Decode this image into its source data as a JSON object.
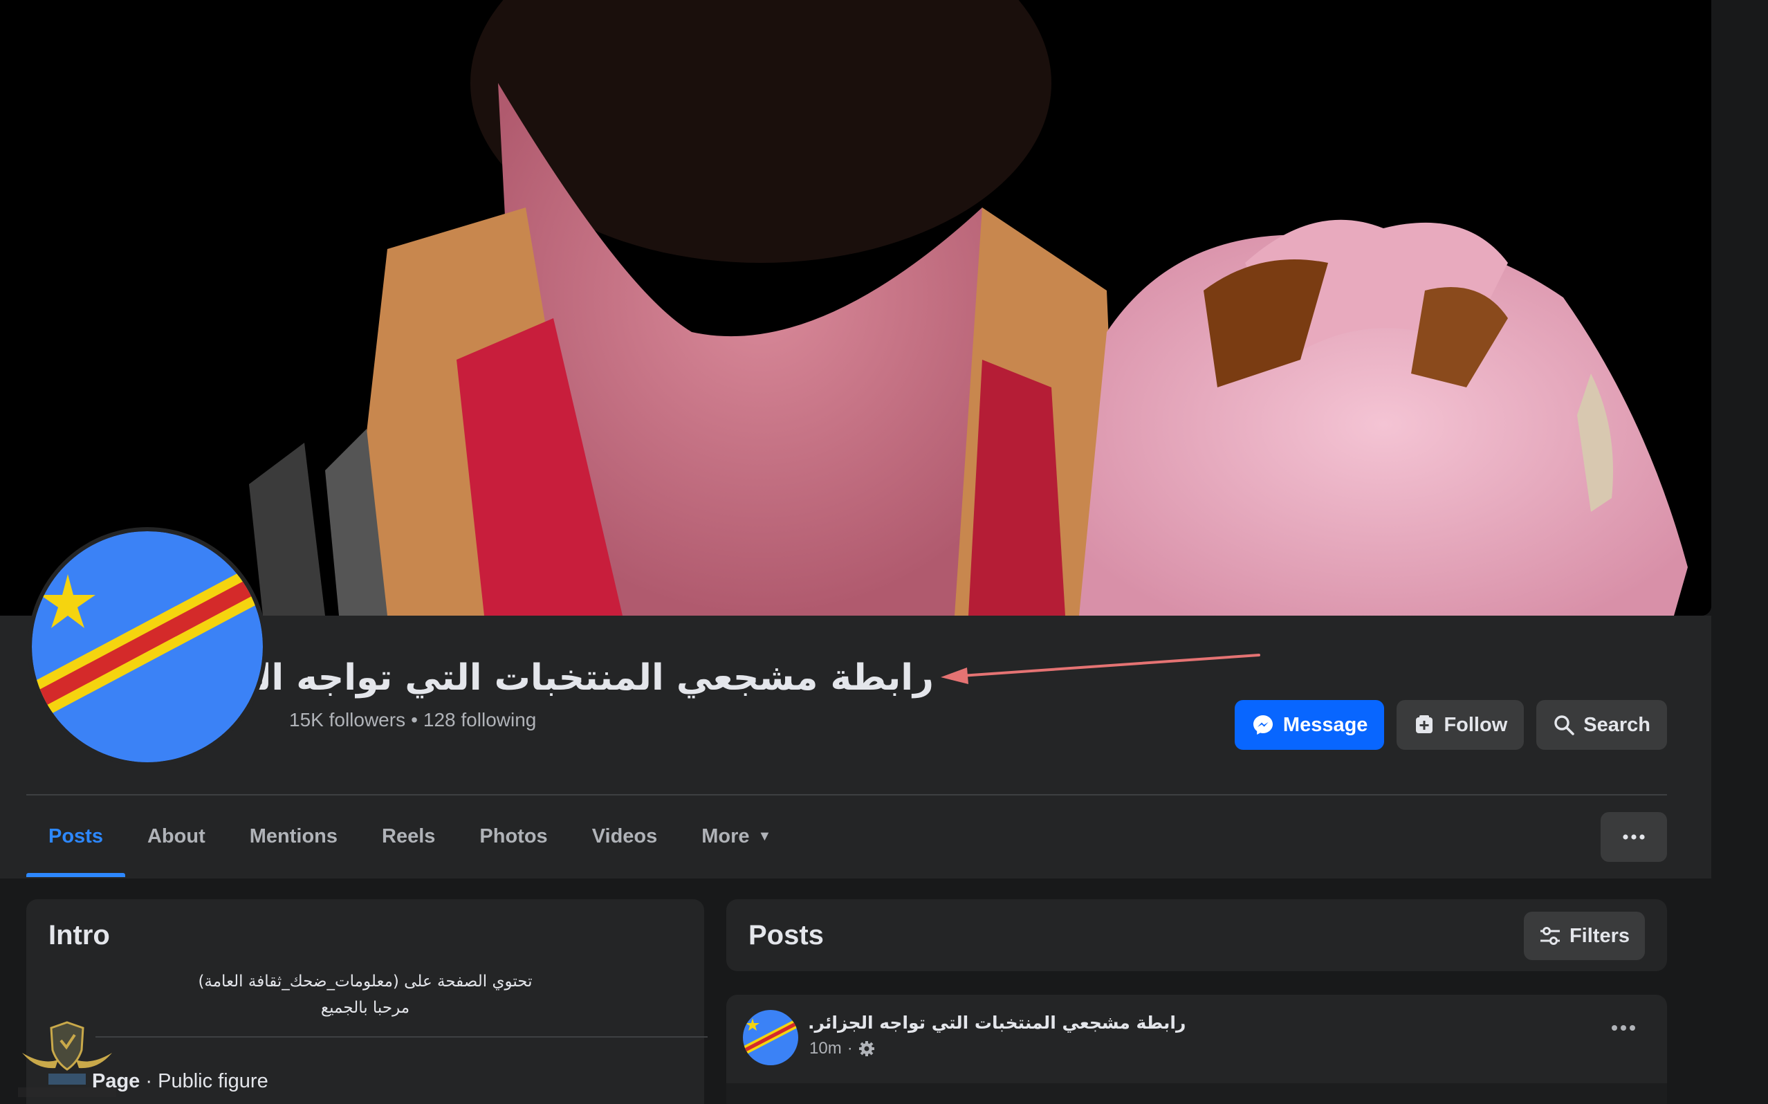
{
  "page": {
    "name": "رابطة مشجعي المنتخبات التي تواجه الجزائر.",
    "followers": "15K followers",
    "separator": "•",
    "following": "128 following"
  },
  "actions": {
    "message": "Message",
    "follow": "Follow",
    "search": "Search"
  },
  "tabs": [
    {
      "label": "Posts",
      "active": true
    },
    {
      "label": "About"
    },
    {
      "label": "Mentions"
    },
    {
      "label": "Reels"
    },
    {
      "label": "Photos"
    },
    {
      "label": "Videos"
    },
    {
      "label": "More"
    }
  ],
  "intro": {
    "title": "Intro",
    "bio_line1": "تحتوي الصفحة على (معلومات_ضحك_ثقافة العامة)",
    "bio_line2": "مرحبا بالجميع",
    "category_type": "Page",
    "category_sep": " · ",
    "category": "Public figure"
  },
  "posts_section": {
    "title": "Posts",
    "filters_label": "Filters"
  },
  "post": {
    "author": "رابطة مشجعي المنتخبات التي تواجه الجزائر.",
    "time": "10m",
    "time_sep": "·"
  },
  "icons": {
    "message": "messenger-icon",
    "follow": "follow-icon",
    "search": "search-icon",
    "more": "ellipsis-icon",
    "filters": "sliders-icon",
    "audience": "gear-icon"
  },
  "colors": {
    "accent": "#0866ff",
    "active_tab": "#2d88ff",
    "annotation_arrow": "#e57373",
    "flag_blue": "#3b82f6",
    "flag_red": "#d42a2a",
    "flag_yellow": "#f5d40f"
  }
}
